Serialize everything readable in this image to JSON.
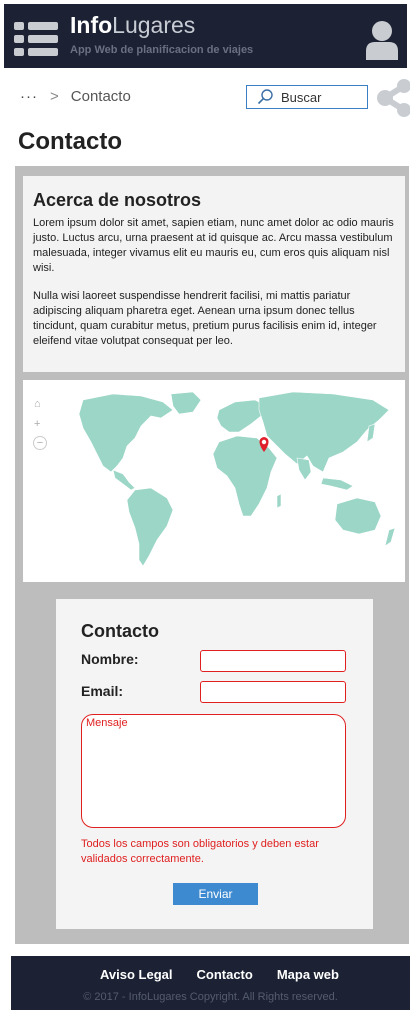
{
  "header": {
    "brand_bold": "Info",
    "brand_light": "Lugares",
    "tagline": "App Web de planificacion de viajes"
  },
  "breadcrumb": {
    "ellipsis": "···",
    "separator": ">",
    "current": "Contacto"
  },
  "search": {
    "placeholder": "Buscar"
  },
  "page": {
    "title": "Contacto"
  },
  "about": {
    "title": "Acerca de nosotros",
    "paragraphs": [
      "Lorem ipsum dolor sit amet, sapien etiam, nunc amet dolor ac odio mauris justo. Luctus arcu, urna praesent at id quisque ac. Arcu massa vestibulum malesuada, integer vivamus elit eu mauris eu, cum eros quis aliquam nisl wisi.",
      "Nulla wisi laoreet suspendisse hendrerit facilisi, mi mattis pariatur adipiscing aliquam pharetra eget. Aenean urna ipsum donec tellus tincidunt, quam curabitur metus, pretium purus facilisis enim id, integer eleifend vitae volutpat consequat per leo."
    ]
  },
  "map": {
    "controls": [
      "⌂",
      "+",
      "−"
    ],
    "land_color": "#9bd6c6",
    "marker_color": "#e0202a"
  },
  "contact_form": {
    "title": "Contacto",
    "name_label": "Nombre:",
    "email_label": "Email:",
    "message_placeholder": "Mensaje",
    "error_text": "Todos los campos son obligatorios y deben estar validados correctamente.",
    "submit_label": "Enviar"
  },
  "footer": {
    "links": [
      "Aviso Legal",
      "Contacto",
      "Mapa web"
    ],
    "copyright": "© 2017 - InfoLugares Copyright. All Rights reserved."
  },
  "colors": {
    "header_bg": "#1c2233",
    "accent": "#3d8ad0",
    "error": "#e02020"
  }
}
